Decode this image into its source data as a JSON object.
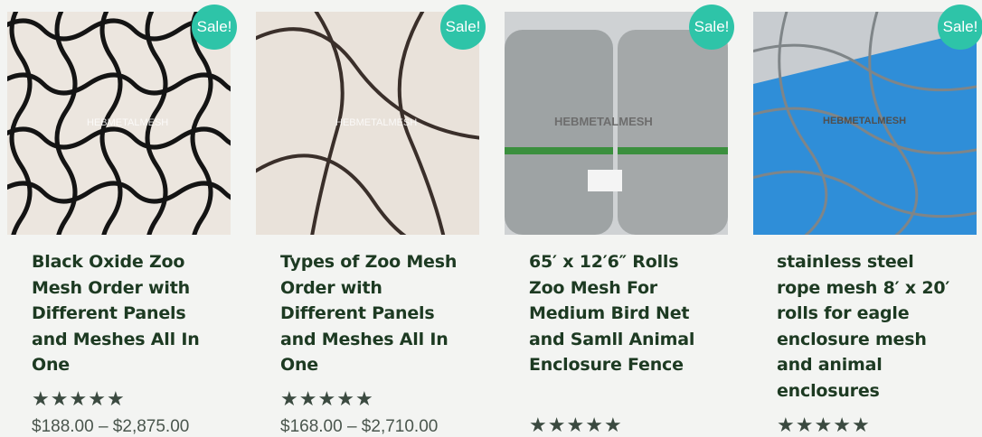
{
  "sale_badge": "Sale!",
  "star_glyph": "★",
  "watermark": "HEBMETALMESH",
  "products": [
    {
      "title": "Black Oxide Zoo Mesh Order with Different Panels and Meshes All In One",
      "rating": 5,
      "price": "$188.00 – $2,875.00",
      "image_icon": "black-zoo-mesh-image"
    },
    {
      "title": "Types of Zoo Mesh Order with Different Panels and Meshes All In One",
      "rating": 5,
      "price": "$168.00 – $2,710.00",
      "image_icon": "stainless-rope-mesh-image"
    },
    {
      "title": "65′ x 12′6″ Rolls Zoo Mesh For Medium Bird Net and Samll Animal Enclosure Fence",
      "rating": 5,
      "price": "",
      "image_icon": "mesh-rolls-image"
    },
    {
      "title": "stainless steel rope mesh 8′ x 20′ rolls for eagle enclosure mesh and animal enclosures",
      "rating": 5,
      "price": "",
      "image_icon": "mesh-over-tarp-image"
    }
  ],
  "colors": {
    "background": "#f3f4f2",
    "sale_badge": "#2ec4a8",
    "title_text": "#1d3a22",
    "stars": "#3b4a40"
  }
}
